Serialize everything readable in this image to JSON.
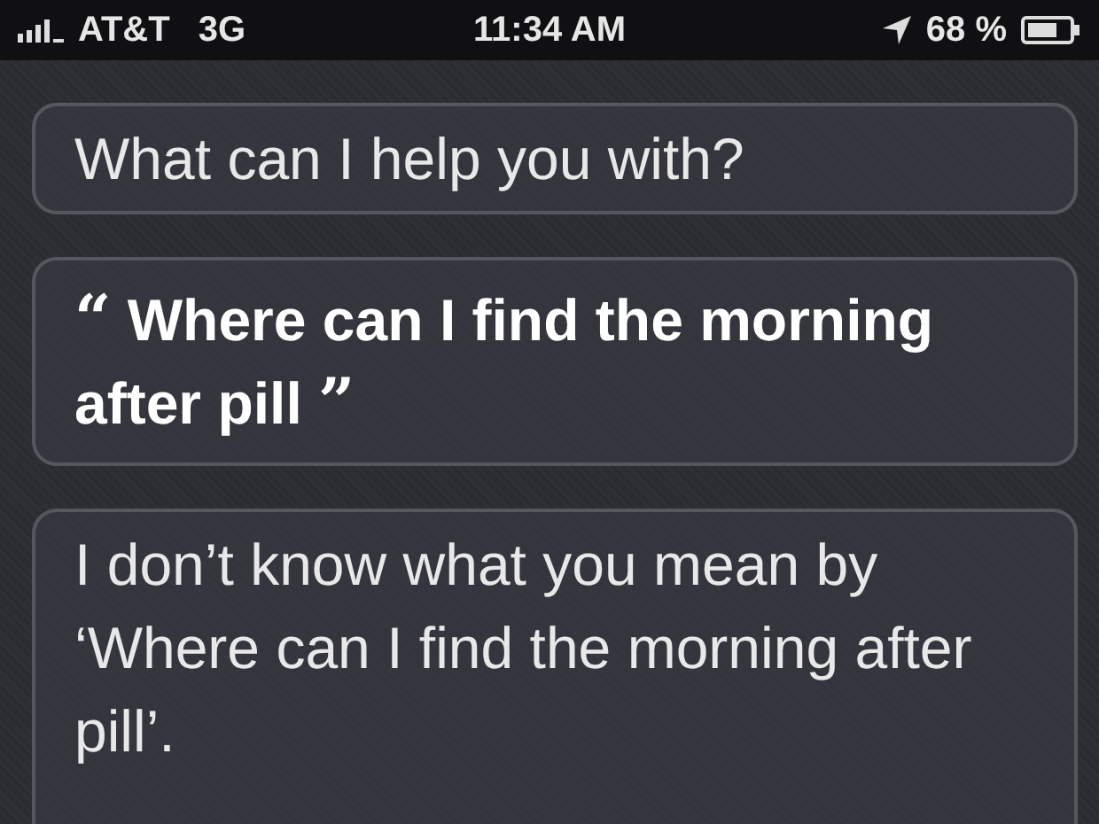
{
  "status_bar": {
    "carrier": "AT&T",
    "network": "3G",
    "time": "11:34 AM",
    "battery_percent": "68 %"
  },
  "messages": [
    {
      "kind": "assistant",
      "text": "What can I help you with?"
    },
    {
      "kind": "user",
      "open_quote": "“",
      "text": "Where can I find the morning after pill",
      "close_quote": "”"
    },
    {
      "kind": "assistant",
      "text": "I don’t know what you mean by ‘Where can I find the morning after pill’."
    }
  ]
}
